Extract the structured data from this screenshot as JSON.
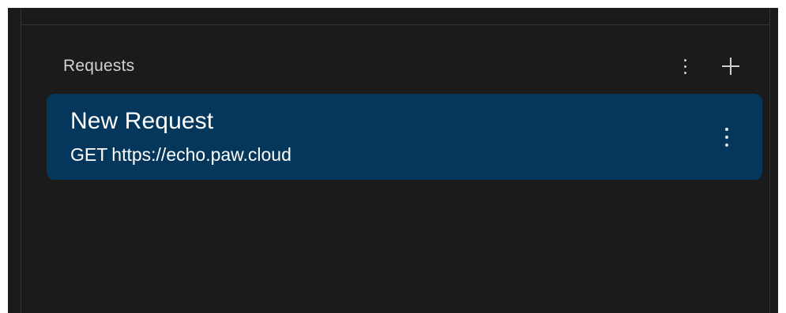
{
  "sidebar": {
    "section_title": "Requests",
    "header_actions": [
      {
        "icon": "kebab-vertical-icon",
        "label": "More options"
      },
      {
        "icon": "plus-icon",
        "label": "Add request"
      }
    ],
    "requests": [
      {
        "name": "New Request",
        "method": "GET",
        "url": "https://echo.paw.cloud",
        "selected": true,
        "menu_icon": "kebab-vertical-icon"
      }
    ]
  },
  "colors": {
    "background": "#1b1b1b",
    "border": "#343434",
    "selected_item": "#04375b",
    "title_text": "#d2d2d2",
    "item_text": "#ffffff"
  }
}
